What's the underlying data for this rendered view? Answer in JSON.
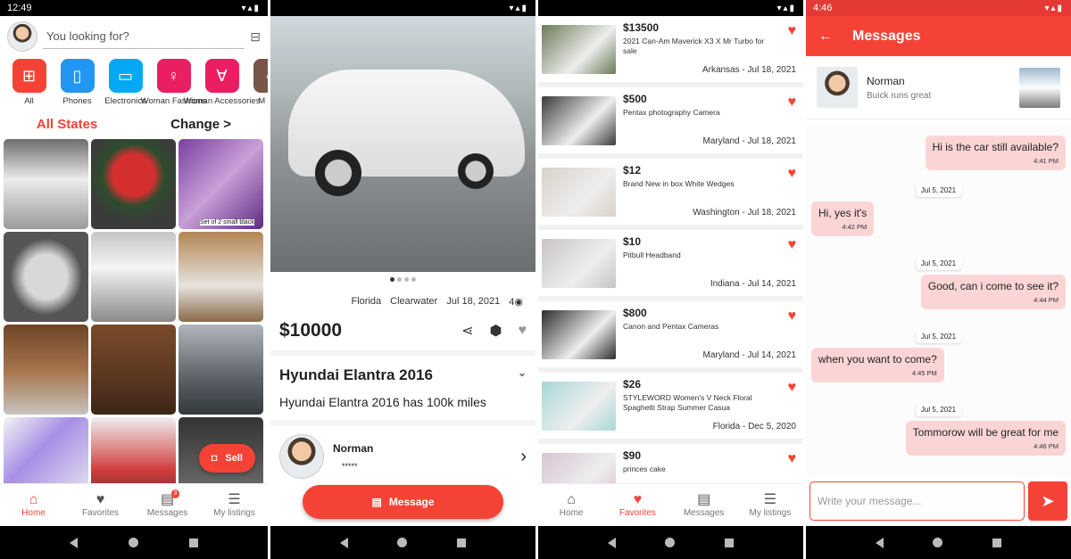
{
  "statusbar": {
    "time1": "12:49",
    "time4": "4:46"
  },
  "home": {
    "search_placeholder": "You looking for?",
    "categories": [
      {
        "label": "All",
        "color": "#f44336",
        "icon": "grid-icon"
      },
      {
        "label": "Phones",
        "color": "#2196f3",
        "icon": "phone-icon"
      },
      {
        "label": "Electronics",
        "color": "#03a9f4",
        "icon": "devices-icon"
      },
      {
        "label": "Woman Fashions",
        "color": "#e91e63",
        "icon": "woman-icon"
      },
      {
        "label": "Woman Accessories",
        "color": "#e91e63",
        "icon": "necklace-icon"
      },
      {
        "label": "M Fas",
        "color": "#795548",
        "icon": "man-icon"
      }
    ],
    "all_states": "All States",
    "change": "Change >",
    "sell": "Sell",
    "grid_caption": "Set of 2 small black"
  },
  "tabs": {
    "home": "Home",
    "favorites": "Favorites",
    "messages": "Messages",
    "listings": "My listings",
    "messages_badge": "3"
  },
  "detail": {
    "state": "Florida",
    "city": "Clearwater",
    "date": "Jul 18, 2021",
    "views": "4",
    "price": "$10000",
    "title": "Hyundai Elantra 2016",
    "description": "Hyundai Elantra 2016 has 100k miles",
    "seller_name": "Norman",
    "seller_rating": "*****",
    "message_button": "Message"
  },
  "favorites": [
    {
      "price": "$13500",
      "title": "2021 Can-Am Maverick X3 X Mr Turbo for sale",
      "location": "Arkansas - Jul 18, 2021",
      "color": "#6b7a57"
    },
    {
      "price": "$500",
      "title": "Pentax photography  Camera",
      "location": "Maryland - Jul 18, 2021",
      "color": "#3a3a3a"
    },
    {
      "price": "$12",
      "title": "Brand New in box White Wedges",
      "location": "Washington - Jul 18, 2021",
      "color": "#d9d2c8"
    },
    {
      "price": "$10",
      "title": "Pitbull Headband",
      "location": "Indiana - Jul 14, 2021",
      "color": "#c9c3c4"
    },
    {
      "price": "$800",
      "title": "Canon and Pentax Cameras",
      "location": "Maryland - Jul 14, 2021",
      "color": "#2c2c2c"
    },
    {
      "price": "$26",
      "title": "STYLEWORD Women's V Neck Floral Spaghetti Strap Summer Casua",
      "location": "Florida - Dec 5, 2020",
      "color": "#a8d6d8"
    },
    {
      "price": "$90",
      "title": "princes cake",
      "location": "",
      "color": "#d8c4d4"
    }
  ],
  "chat": {
    "title": "Messages",
    "contact_name": "Norman",
    "contact_subtitle": "Buick runs great",
    "input_placeholder": "Write your message...",
    "messages": [
      {
        "text": "Hi is the car still available?",
        "time": "4:41 PM",
        "side": "right"
      },
      {
        "date": "Jul 5, 2021"
      },
      {
        "text": "Hi, yes it's",
        "time": "4:42 PM",
        "side": "left"
      },
      {
        "date": "Jul 5, 2021"
      },
      {
        "text": "Good, can i come to see it?",
        "time": "4:44 PM",
        "side": "right"
      },
      {
        "date": "Jul 5, 2021"
      },
      {
        "text": "when you want to come?",
        "time": "4:45 PM",
        "side": "left"
      },
      {
        "date": "Jul 5, 2021"
      },
      {
        "text": "Tommorow will be great for me",
        "time": "4:46 PM",
        "side": "right"
      }
    ]
  }
}
